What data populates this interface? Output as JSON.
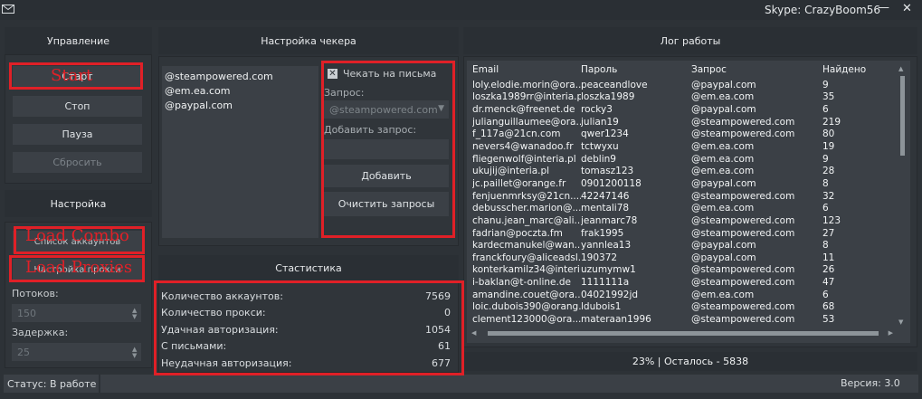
{
  "window": {
    "title": "Skype: CrazyBoom56",
    "minimize": "—",
    "close": "✕"
  },
  "control": {
    "title": "Управление",
    "start": "Старт",
    "stop": "Стоп",
    "pause": "Пауза",
    "reset": "Сбросить"
  },
  "settings": {
    "title": "Настройка",
    "accounts_button": "Список аккаунтов",
    "proxy_button": "Настройка прокси",
    "threads_label": "Потоков:",
    "threads_value": "150",
    "delay_label": "Задержка:",
    "delay_value": "25"
  },
  "checker": {
    "title": "Настройка чекера",
    "domains": [
      "@steampowered.com",
      "@em.ea.com",
      "@paypal.com"
    ],
    "check_mail_label": "Чекать на письма",
    "check_mail_checked": true,
    "query_label": "Запрос:",
    "query_value": "@steampowered.com",
    "add_query_label": "Добавить запрос:",
    "add_button": "Добавить",
    "clear_button": "Очистить запросы"
  },
  "stats": {
    "title": "Стастистика",
    "rows": [
      {
        "label": "Количество аккаунтов:",
        "value": "7569"
      },
      {
        "label": "Количество прокси:",
        "value": "0"
      },
      {
        "label": "Удачная авторизация:",
        "value": "1054"
      },
      {
        "label": "С письмами:",
        "value": "61"
      },
      {
        "label": "Неудачная авторизация:",
        "value": "677"
      }
    ]
  },
  "log": {
    "title": "Лог работы",
    "columns": [
      "Email",
      "Пароль",
      "Запрос",
      "Найдено"
    ],
    "rows": [
      [
        "loly.elodie.morin@ora...",
        "peaceandlove",
        "@paypal.com",
        "9"
      ],
      [
        "loszka1989rr@interia.pl",
        "loszka1989",
        "@em.ea.com",
        "35"
      ],
      [
        "dr.menck@freenet.de",
        "rocky3",
        "@paypal.com",
        "6"
      ],
      [
        "julianguillaumee@ora...",
        "julian19",
        "@steampowered.com",
        "219"
      ],
      [
        "f_117a@21cn.com",
        "qwer1234",
        "@steampowered.com",
        "80"
      ],
      [
        "nevers4@wanadoo.fr",
        "tctwyxu",
        "@em.ea.com",
        "19"
      ],
      [
        "fliegenwolf@interia.pl",
        "deblin9",
        "@em.ea.com",
        "9"
      ],
      [
        "ukujij@interia.pl",
        "tomasz123",
        "@em.ea.com",
        "28"
      ],
      [
        "jc.paillet@orange.fr",
        "0901200118",
        "@paypal.com",
        "8"
      ],
      [
        "fenjuenmrksy@21cn....",
        "42247146",
        "@steampowered.com",
        "32"
      ],
      [
        "debusscher.marion@...",
        "mentali78",
        "@em.ea.com",
        "6"
      ],
      [
        "chanu.jean_marc@ali...",
        "jeanmarc78",
        "@steampowered.com",
        "123"
      ],
      [
        "fadrian@poczta.fm",
        "frak1995",
        "@steampowered.com",
        "27"
      ],
      [
        "kardecmanukel@wan...",
        "yannlea13",
        "@paypal.com",
        "8"
      ],
      [
        "franckfoury@aliceadsl.fr",
        "190372",
        "@paypal.com",
        "11"
      ],
      [
        "konterkamilz34@interi...",
        "uzumymw1",
        "@steampowered.com",
        "26"
      ],
      [
        "i-baklan@t-online.de",
        "1111111a",
        "@steampowered.com",
        "47"
      ],
      [
        "amandine.couet@ora...",
        "04021992jd",
        "@em.ea.com",
        "6"
      ],
      [
        "loic.dubois390@orang...",
        "ldubois1",
        "@steampowered.com",
        "68"
      ],
      [
        "clement123000@ora...",
        "materaan1996",
        "@steampowered.com",
        "53"
      ]
    ],
    "progress_text": "23% | Осталось - 5838"
  },
  "statusbar": {
    "status": "Статус: В работе",
    "version": "Версия: 3.0"
  },
  "annotations": {
    "start": "Start",
    "load_combo": "Load Combo",
    "load_proxies": "Load Proxies"
  },
  "colors": {
    "background": "#2d3237",
    "button": "#3b4046",
    "annotation": "#e02027"
  }
}
